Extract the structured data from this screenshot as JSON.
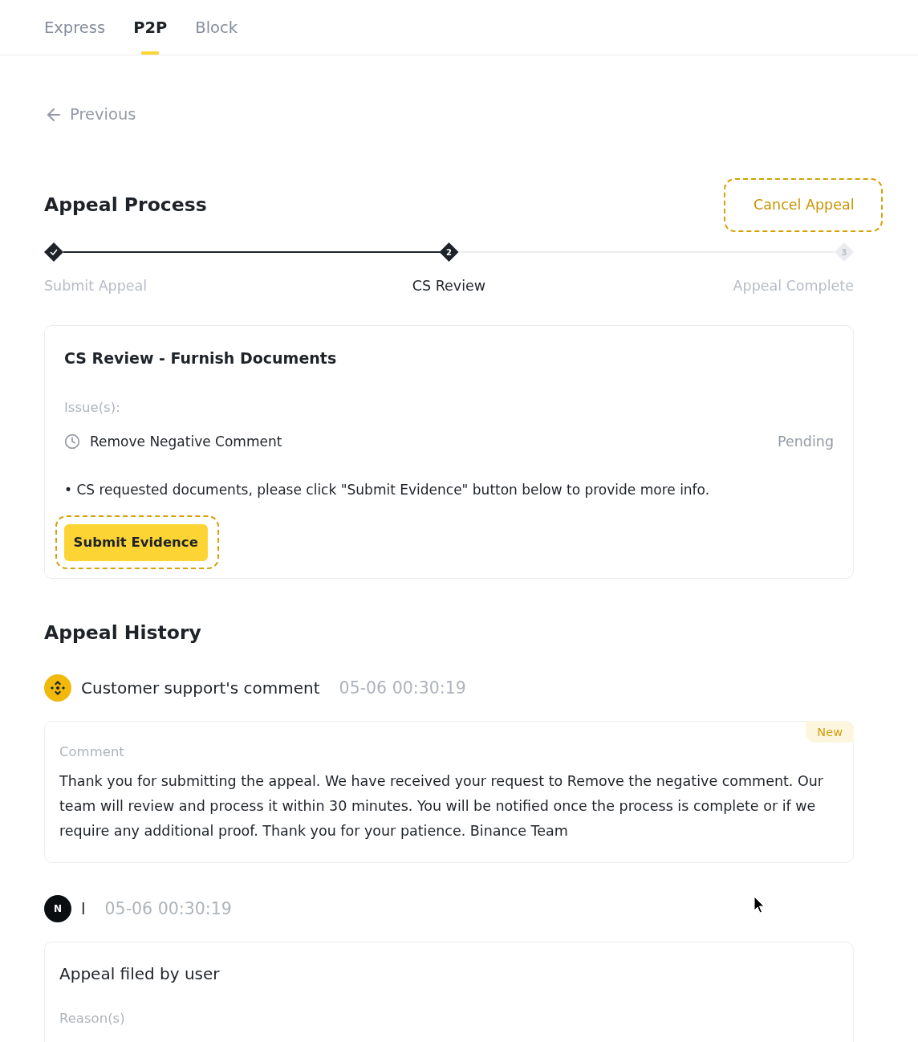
{
  "tabs": [
    {
      "label": "Express",
      "selected": false
    },
    {
      "label": "P2P",
      "selected": true
    },
    {
      "label": "Block",
      "selected": false
    }
  ],
  "back_link": {
    "label": "Previous"
  },
  "process": {
    "title": "Appeal Process",
    "cancel_button": {
      "label": "Cancel Appeal",
      "highlighted": true
    },
    "steps": [
      {
        "label": "Submit Appeal",
        "done": true,
        "active": false
      },
      {
        "label": "CS Review",
        "number": "2",
        "done": false,
        "active": true
      },
      {
        "label": "Appeal Complete",
        "number": "3",
        "done": false,
        "active": false
      }
    ]
  },
  "review_card": {
    "title": "CS Review - Furnish Documents",
    "issues_label": "Issue(s):",
    "issues": [
      {
        "label": "Remove Negative Comment",
        "status": "Pending"
      }
    ],
    "note": "• CS requested documents, please click \"Submit Evidence\" button below to provide more info.",
    "submit_button": {
      "label": "Submit Evidence",
      "highlighted": true
    }
  },
  "history": {
    "title": "Appeal History",
    "entries": [
      {
        "kind": "support",
        "author": "Customer support's comment",
        "time": "05-06 00:30:19",
        "card": {
          "badge": "New",
          "label": "Comment",
          "body": "Thank you for submitting the appeal. We have received your request to Remove the negative comment. Our team will review and process it within 30 minutes. You will be notified once the process is complete or if we require any additional proof. Thank you for your patience. Binance Team"
        }
      },
      {
        "kind": "user",
        "avatar": "N",
        "author": "l",
        "time": "05-06 00:30:19",
        "card": {
          "title": "Appeal filed by user",
          "label": "Reason(s)"
        }
      }
    ]
  }
}
